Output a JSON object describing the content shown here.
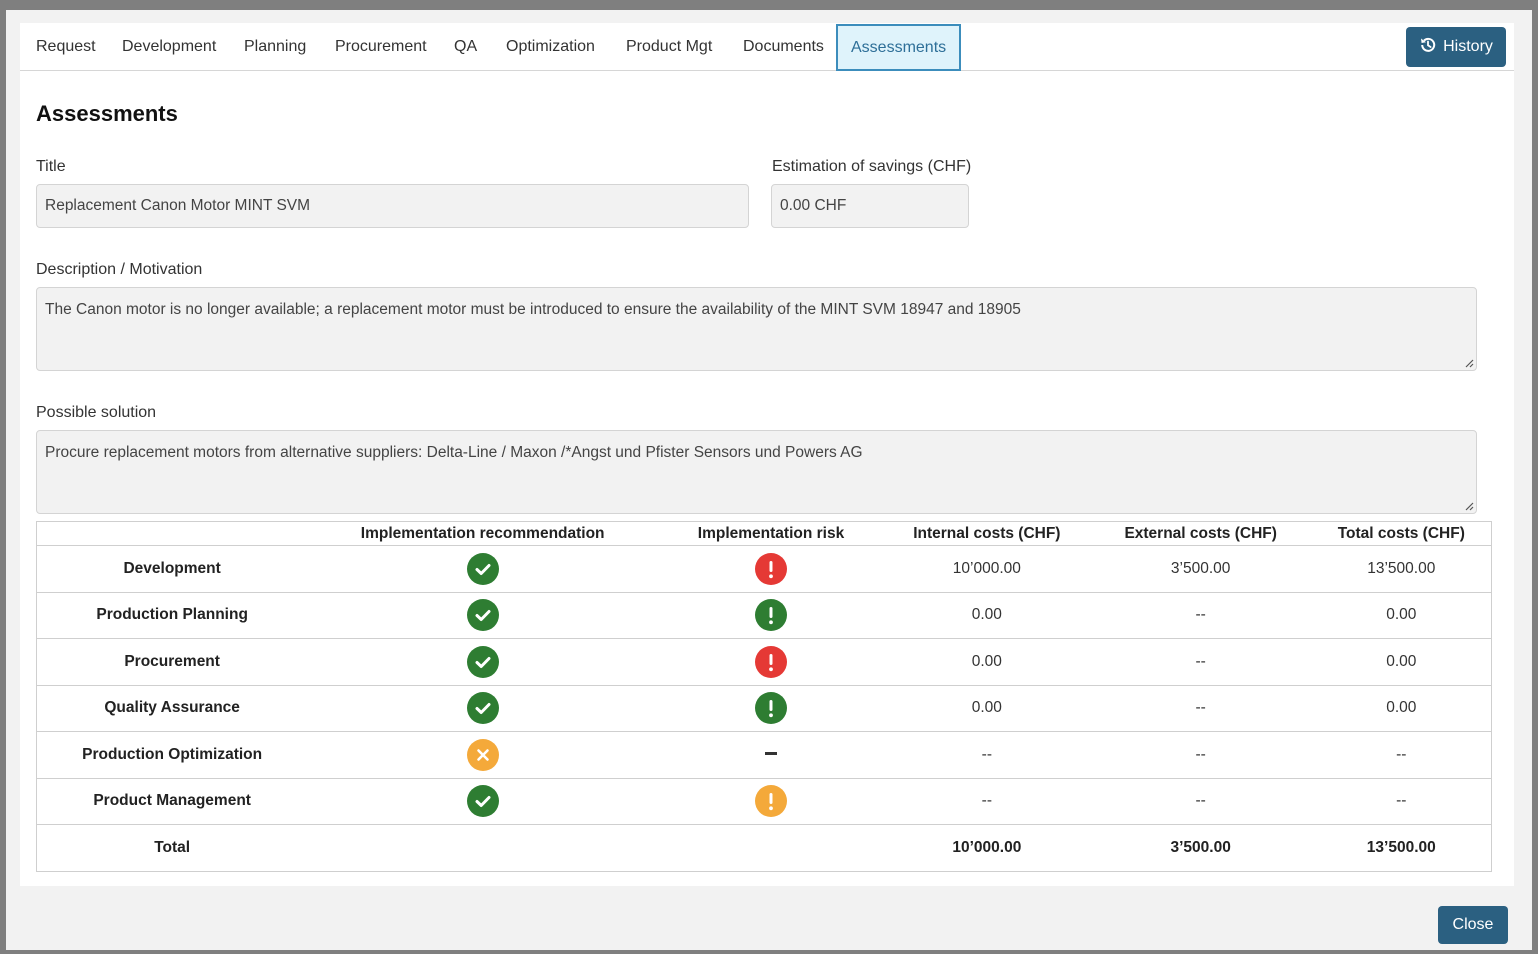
{
  "tabs": [
    {
      "label": "Request"
    },
    {
      "label": "Development"
    },
    {
      "label": "Planning"
    },
    {
      "label": "Procurement"
    },
    {
      "label": "QA"
    },
    {
      "label": "Optimization"
    },
    {
      "label": "Product Mgt"
    },
    {
      "label": "Documents"
    },
    {
      "label": "Assessments",
      "active": true
    }
  ],
  "history_label": "History",
  "page_title": "Assessments",
  "form": {
    "title_label": "Title",
    "title_value": "Replacement Canon Motor MINT SVM",
    "savings_label": "Estimation of savings (CHF)",
    "savings_value": "0.00 CHF",
    "description_label": "Description / Motivation",
    "description_value": "The Canon motor is no longer available; a replacement motor must be introduced to ensure the availability of the MINT SVM 18947 and 18905",
    "solution_label": "Possible solution",
    "solution_value": "Procure replacement motors from alternative suppliers: Delta-Line / Maxon /*Angst und Pfister Sensors und Powers AG"
  },
  "table": {
    "headers": [
      "",
      "Implementation recommendation",
      "Implementation risk",
      "Internal costs (CHF)",
      "External costs (CHF)",
      "Total costs (CHF)"
    ],
    "rows": [
      {
        "name": "Development",
        "recommendation": "check-green",
        "risk": "alert-red",
        "internal": "10’000.00",
        "external": "3’500.00",
        "total": "13’500.00"
      },
      {
        "name": "Production Planning",
        "recommendation": "check-green",
        "risk": "alert-green",
        "internal": "0.00",
        "external": "--",
        "total": "0.00"
      },
      {
        "name": "Procurement",
        "recommendation": "check-green",
        "risk": "alert-red",
        "internal": "0.00",
        "external": "--",
        "total": "0.00"
      },
      {
        "name": "Quality Assurance",
        "recommendation": "check-green",
        "risk": "alert-green",
        "internal": "0.00",
        "external": "--",
        "total": "0.00"
      },
      {
        "name": "Production Optimization",
        "recommendation": "x-orange",
        "risk": "dash",
        "internal": "--",
        "external": "--",
        "total": "--"
      },
      {
        "name": "Product Management",
        "recommendation": "check-green",
        "risk": "alert-orange",
        "internal": "--",
        "external": "--",
        "total": "--"
      }
    ],
    "total_row": {
      "name": "Total",
      "internal": "10’000.00",
      "external": "3’500.00",
      "total": "13’500.00"
    }
  },
  "close_label": "Close",
  "colors": {
    "primary": "#2b6081",
    "green": "#2e7d32",
    "red": "#e53935",
    "orange": "#f4a93a",
    "tab_active_bg": "#dff3fb",
    "tab_active_border": "#3c8dbc"
  }
}
